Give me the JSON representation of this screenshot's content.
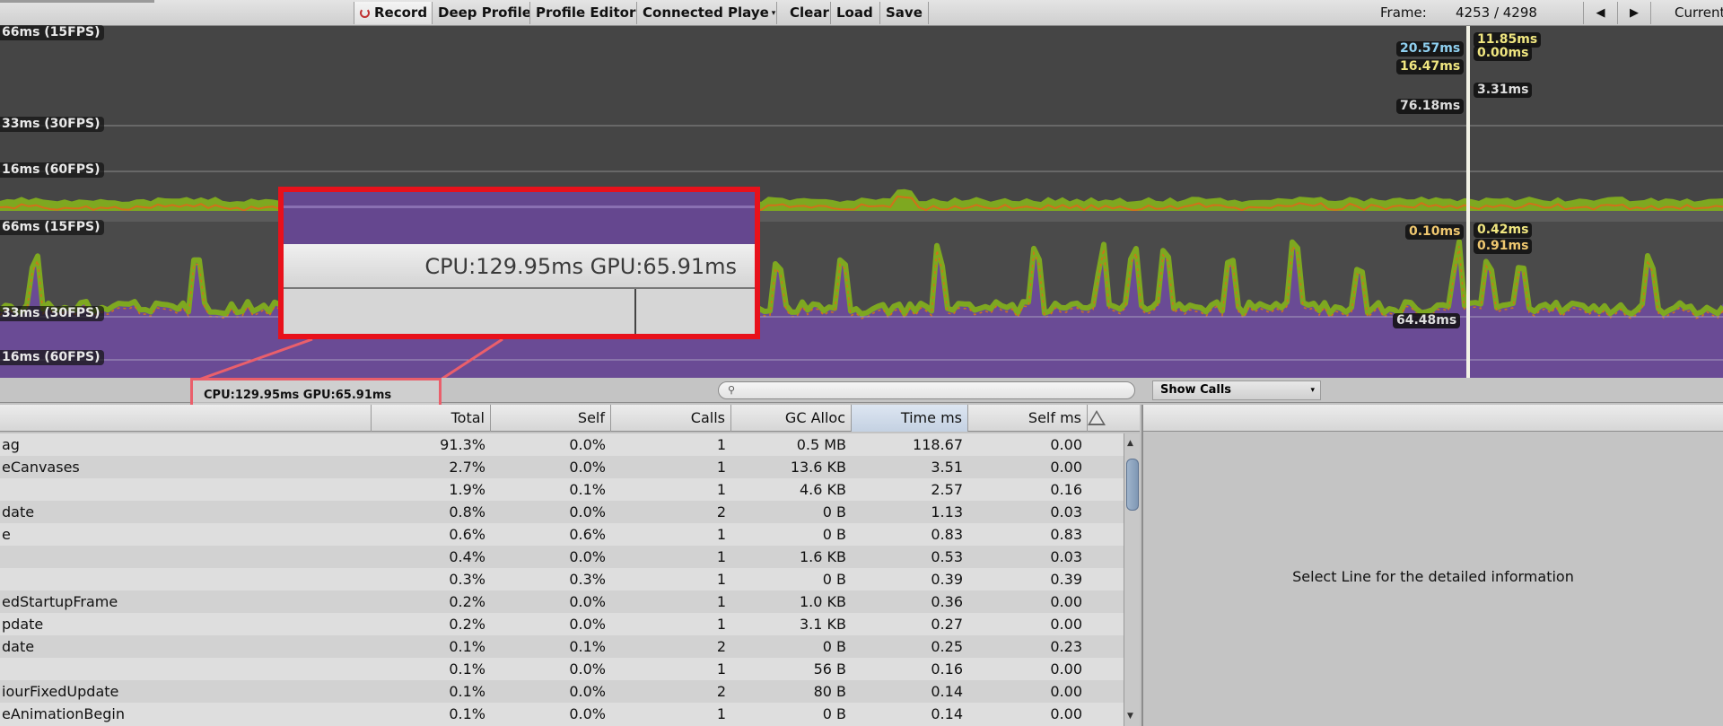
{
  "toolbar": {
    "record": "Record",
    "deep_profile": "Deep Profile",
    "profile_editor": "Profile Editor",
    "connected_player": "Connected Playe",
    "clear": "Clear",
    "load": "Load",
    "save": "Save",
    "frame_label": "Frame:",
    "frame_value": "4253 / 4298",
    "current": "Current"
  },
  "charts": {
    "top_axis": [
      "66ms (15FPS)",
      "33ms (30FPS)",
      "16ms (60FPS)"
    ],
    "bottom_axis": [
      "66ms (15FPS)",
      "33ms (30FPS)",
      "16ms (60FPS)"
    ],
    "top_values": [
      "20.57ms",
      "16.47ms",
      "76.18ms",
      "3.31ms",
      "11.85ms",
      "0.00ms"
    ],
    "bottom_values": [
      "0.10ms",
      "0.42ms",
      "0.91ms",
      "64.48ms"
    ],
    "colors": {
      "purple": "#6a4b95",
      "green": "#7ea820",
      "orange": "#d2701a",
      "yellow": "#d8d21e"
    }
  },
  "callout": {
    "text": "CPU:129.95ms   GPU:65.91ms"
  },
  "stats": {
    "cpu_gpu": "CPU:129.95ms   GPU:65.91ms",
    "show_calls": "Show Calls",
    "search_placeholder": ""
  },
  "columns": [
    "",
    "Total",
    "Self",
    "Calls",
    "GC Alloc",
    "Time ms",
    "Self ms"
  ],
  "rows": [
    [
      "ag",
      "91.3%",
      "0.0%",
      "1",
      "0.5 MB",
      "118.67",
      "0.00"
    ],
    [
      "eCanvases",
      "2.7%",
      "0.0%",
      "1",
      "13.6 KB",
      "3.51",
      "0.00"
    ],
    [
      "",
      "1.9%",
      "0.1%",
      "1",
      "4.6 KB",
      "2.57",
      "0.16"
    ],
    [
      "date",
      "0.8%",
      "0.0%",
      "2",
      "0 B",
      "1.13",
      "0.03"
    ],
    [
      "e",
      "0.6%",
      "0.6%",
      "1",
      "0 B",
      "0.83",
      "0.83"
    ],
    [
      "",
      "0.4%",
      "0.0%",
      "1",
      "1.6 KB",
      "0.53",
      "0.03"
    ],
    [
      "",
      "0.3%",
      "0.3%",
      "1",
      "0 B",
      "0.39",
      "0.39"
    ],
    [
      "edStartupFrame",
      "0.2%",
      "0.0%",
      "1",
      "1.0 KB",
      "0.36",
      "0.00"
    ],
    [
      "pdate",
      "0.2%",
      "0.0%",
      "1",
      "3.1 KB",
      "0.27",
      "0.00"
    ],
    [
      "date",
      "0.1%",
      "0.1%",
      "2",
      "0 B",
      "0.25",
      "0.23"
    ],
    [
      "",
      "0.1%",
      "0.0%",
      "1",
      "56 B",
      "0.16",
      "0.00"
    ],
    [
      "iourFixedUpdate",
      "0.1%",
      "0.0%",
      "2",
      "80 B",
      "0.14",
      "0.00"
    ],
    [
      "eAnimationBegin",
      "0.1%",
      "0.0%",
      "1",
      "0 B",
      "0.14",
      "0.00"
    ]
  ],
  "detail": {
    "message": "Select Line for the detailed information"
  }
}
